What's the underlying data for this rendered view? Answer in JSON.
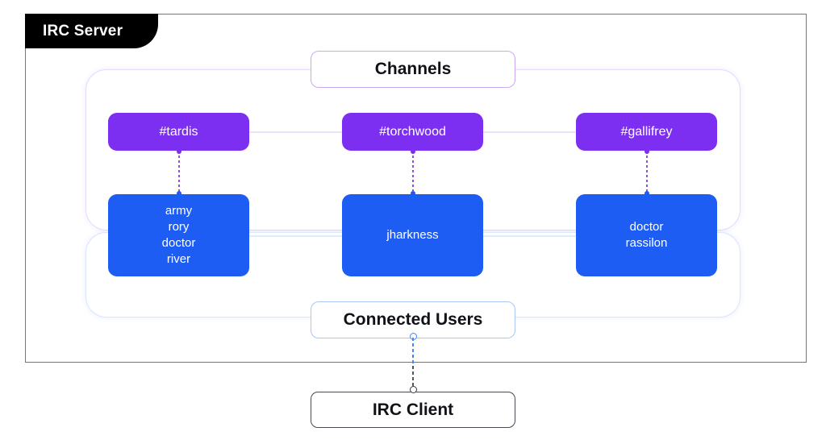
{
  "server": {
    "label": "IRC Server"
  },
  "channels_section": {
    "title": "Channels",
    "nodes": [
      {
        "name": "#tardis"
      },
      {
        "name": "#torchwood"
      },
      {
        "name": "#gallifrey"
      }
    ]
  },
  "users_section": {
    "title": "Connected Users",
    "nodes": [
      {
        "users": [
          "army",
          "rory",
          "doctor",
          "river"
        ]
      },
      {
        "users": [
          "jharkness"
        ]
      },
      {
        "users": [
          "doctor",
          "rassilon"
        ]
      }
    ]
  },
  "client": {
    "label": "IRC Client"
  },
  "colors": {
    "channel_fill": "#7c2ff0",
    "user_fill": "#1d5df4",
    "channel_border": "#c9a8f6",
    "user_border": "#a9c6f7",
    "server_border": "#767680",
    "tab_background": "#000000"
  }
}
